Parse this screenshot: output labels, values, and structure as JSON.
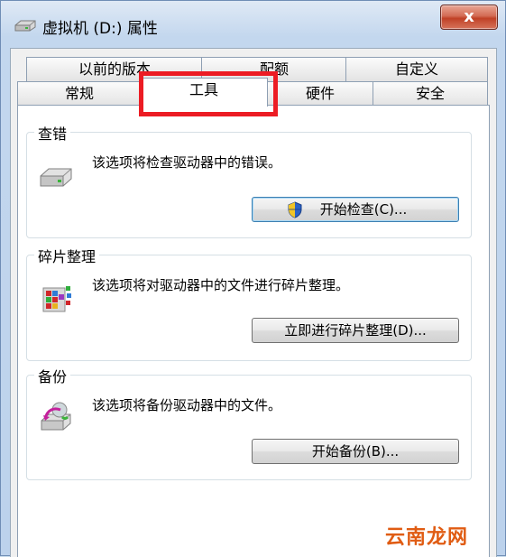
{
  "window": {
    "title": "虚拟机 (D:) 属性",
    "close_label": "x"
  },
  "tabs_row1": [
    {
      "label": "以前的版本"
    },
    {
      "label": "配额"
    },
    {
      "label": "自定义"
    }
  ],
  "tabs_row2": [
    {
      "label": "常规"
    },
    {
      "label": "工具",
      "active": true
    },
    {
      "label": "硬件"
    },
    {
      "label": "安全"
    }
  ],
  "groups": {
    "check": {
      "title": "查错",
      "description": "该选项将检查驱动器中的错误。",
      "button": "开始检查(C)...",
      "icon": "drive-icon"
    },
    "defrag": {
      "title": "碎片整理",
      "description": "该选项将对驱动器中的文件进行碎片整理。",
      "button": "立即进行碎片整理(D)...",
      "icon": "defrag-icon"
    },
    "backup": {
      "title": "备份",
      "description": "该选项将备份驱动器中的文件。",
      "button": "开始备份(B)...",
      "icon": "backup-icon"
    }
  },
  "watermark": "云南龙网",
  "colors": {
    "highlight": "#ec1c24",
    "watermark": "#e05c13"
  }
}
